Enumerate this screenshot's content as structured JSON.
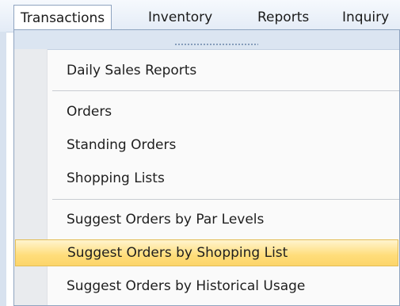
{
  "menubar": {
    "items": [
      {
        "label": "Transactions",
        "active": true
      },
      {
        "label": "Inventory"
      },
      {
        "label": "Reports"
      },
      {
        "label": "Inquiry"
      }
    ]
  },
  "dropdown": {
    "groups": [
      [
        {
          "label": "Daily Sales Reports"
        }
      ],
      [
        {
          "label": "Orders"
        },
        {
          "label": "Standing Orders"
        },
        {
          "label": "Shopping Lists"
        }
      ],
      [
        {
          "label": "Suggest Orders by Par Levels"
        },
        {
          "label": "Suggest Orders by Shopping List",
          "highlighted": true
        },
        {
          "label": "Suggest Orders by Historical Usage"
        }
      ]
    ]
  },
  "colors": {
    "menubar_bg": "#e3ebf6",
    "highlight": "#ffdd7a",
    "gutter": "#e9ebee"
  }
}
